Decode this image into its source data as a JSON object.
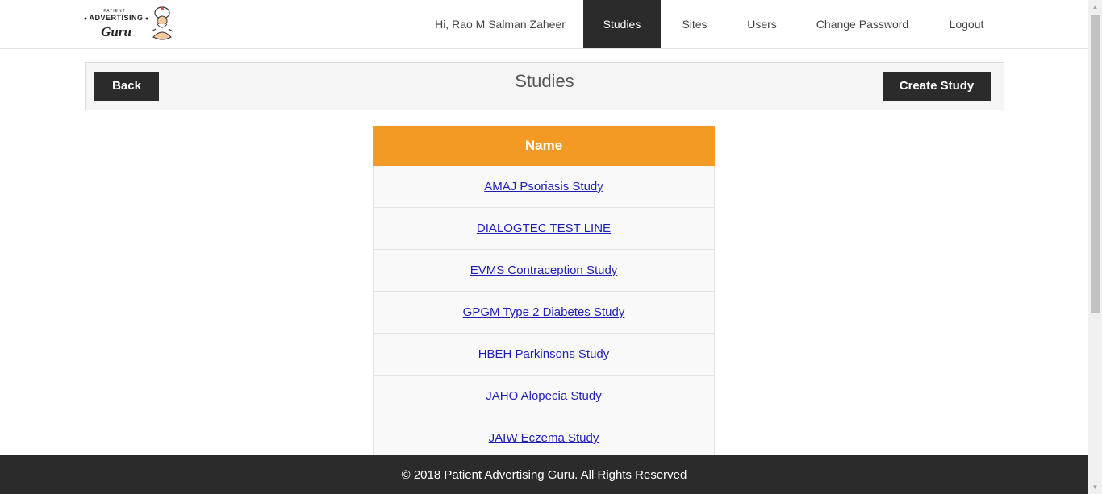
{
  "nav": {
    "logo_text_top": "PATIENT",
    "logo_text_mid": "ADVERTISING",
    "logo_text_script": "Guru",
    "greeting": "Hi, Rao M Salman Zaheer",
    "items": [
      {
        "label": "Studies",
        "active": true
      },
      {
        "label": "Sites"
      },
      {
        "label": "Users"
      },
      {
        "label": "Change Password"
      },
      {
        "label": "Logout"
      }
    ]
  },
  "panel": {
    "back_label": "Back",
    "title": "Studies",
    "create_label": "Create Study"
  },
  "table": {
    "header": "Name",
    "rows": [
      "AMAJ Psoriasis Study",
      "DIALOGTEC TEST LINE",
      "EVMS Contraception Study",
      "GPGM Type 2 Diabetes Study",
      "HBEH Parkinsons Study",
      "JAHO Alopecia Study",
      "JAIW Eczema Study"
    ]
  },
  "footer": {
    "text": "© 2018 Patient Advertising Guru. All Rights Reserved"
  },
  "colors": {
    "accent": "#f39a25",
    "dark": "#2b2b2b",
    "link": "#1f1fb8"
  },
  "icons": {
    "scroll_up": "scroll-up-arrow-icon",
    "scroll_down": "scroll-down-arrow-icon"
  }
}
